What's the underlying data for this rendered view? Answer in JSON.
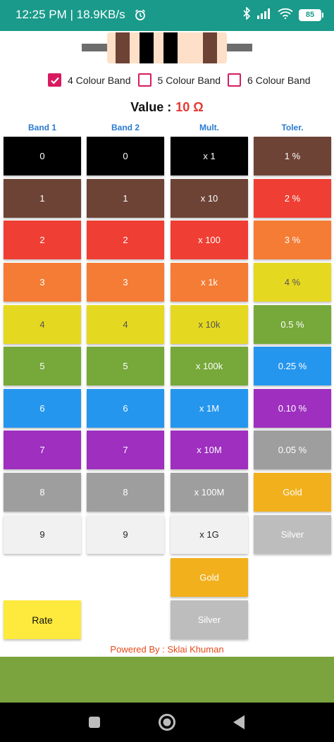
{
  "status_bar": {
    "time_text": "12:25 PM | 18.9KB/s",
    "battery": "85"
  },
  "options": [
    {
      "label": "4 Colour Band",
      "checked": true
    },
    {
      "label": "5 Colour Band",
      "checked": false
    },
    {
      "label": "6 Colour Band",
      "checked": false
    }
  ],
  "value": {
    "label": "Value :",
    "amount": "10 Ω"
  },
  "headers": [
    "Band 1",
    "Band 2",
    "Mult.",
    "Toler."
  ],
  "colors": {
    "black": "#000000",
    "brown": "#6d4336",
    "red": "#ef3e33",
    "orange": "#f47c34",
    "yellow": "#e5d820",
    "green": "#76a83a",
    "blue": "#2596ee",
    "violet": "#9e2fbf",
    "grey": "#9e9e9e",
    "white": "#f1f1f1",
    "gold": "#f1b01c",
    "silver": "#bdbdbd",
    "rate_yellow": "#fdea3c",
    "accent_pink": "#d81b60",
    "value_red": "#e53935"
  },
  "band1": [
    "0",
    "1",
    "2",
    "3",
    "4",
    "5",
    "6",
    "7",
    "8",
    "9"
  ],
  "band2": [
    "0",
    "1",
    "2",
    "3",
    "4",
    "5",
    "6",
    "7",
    "8",
    "9"
  ],
  "multiplier": [
    "x 1",
    "x 10",
    "x 100",
    "x 1k",
    "x 10k",
    "x 100k",
    "x 1M",
    "x 10M",
    "x 100M",
    "x 1G",
    "Gold",
    "Silver"
  ],
  "tolerance": [
    "1 %",
    "2 %",
    "3 %",
    "4 %",
    "0.5 %",
    "0.25 %",
    "0.10 %",
    "0.05 %",
    "Gold",
    "Silver"
  ],
  "rate_button": "Rate",
  "powered_by": "Powered By : Sklai Khuman",
  "resistor_bands": [
    "brown",
    "black",
    "black",
    "brown"
  ]
}
